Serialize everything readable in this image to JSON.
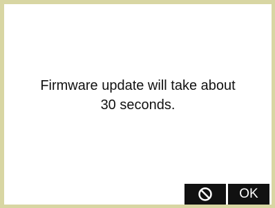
{
  "dialog": {
    "message_line1": "Firmware update will take about",
    "message_line2": "30 seconds.",
    "cancel_icon": "cancel-icon",
    "ok_label": "OK"
  },
  "colors": {
    "frame": "#d8d6a3",
    "background": "#ffffff",
    "softkey_bg": "#111111",
    "softkey_fg": "#ffffff",
    "text": "#111111"
  }
}
